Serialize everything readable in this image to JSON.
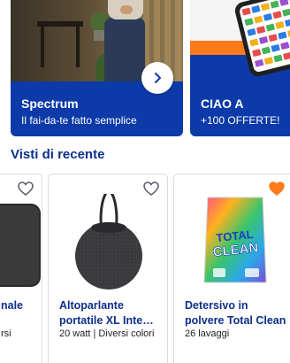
{
  "promos": [
    {
      "title": "Spectrum",
      "subtitle": "Il fai-da-te fatto semplice"
    },
    {
      "title": "CIAO A",
      "subtitle": "+100 OFFERTE!"
    }
  ],
  "recent": {
    "heading": "Visti di recente",
    "items": [
      {
        "name": "nale",
        "detail": "rsi",
        "favorited": false
      },
      {
        "name": "Altoparlante portatile XL Inte…",
        "detail": "20 watt | Diversi colori",
        "favorited": false
      },
      {
        "name": "Detersivo in polvere Total Clean",
        "detail": "26 lavaggi",
        "favorited": true
      }
    ]
  },
  "product_image_text": {
    "brand_top": "TOTAL",
    "brand_bottom": "CLEAN"
  },
  "colors": {
    "brand_blue": "#0c3aa8",
    "heading_blue": "#0c2f8a",
    "favorite_orange": "#ff7a1a"
  },
  "icons": {
    "next": "chevron-right-icon",
    "favorite": "heart-icon"
  }
}
